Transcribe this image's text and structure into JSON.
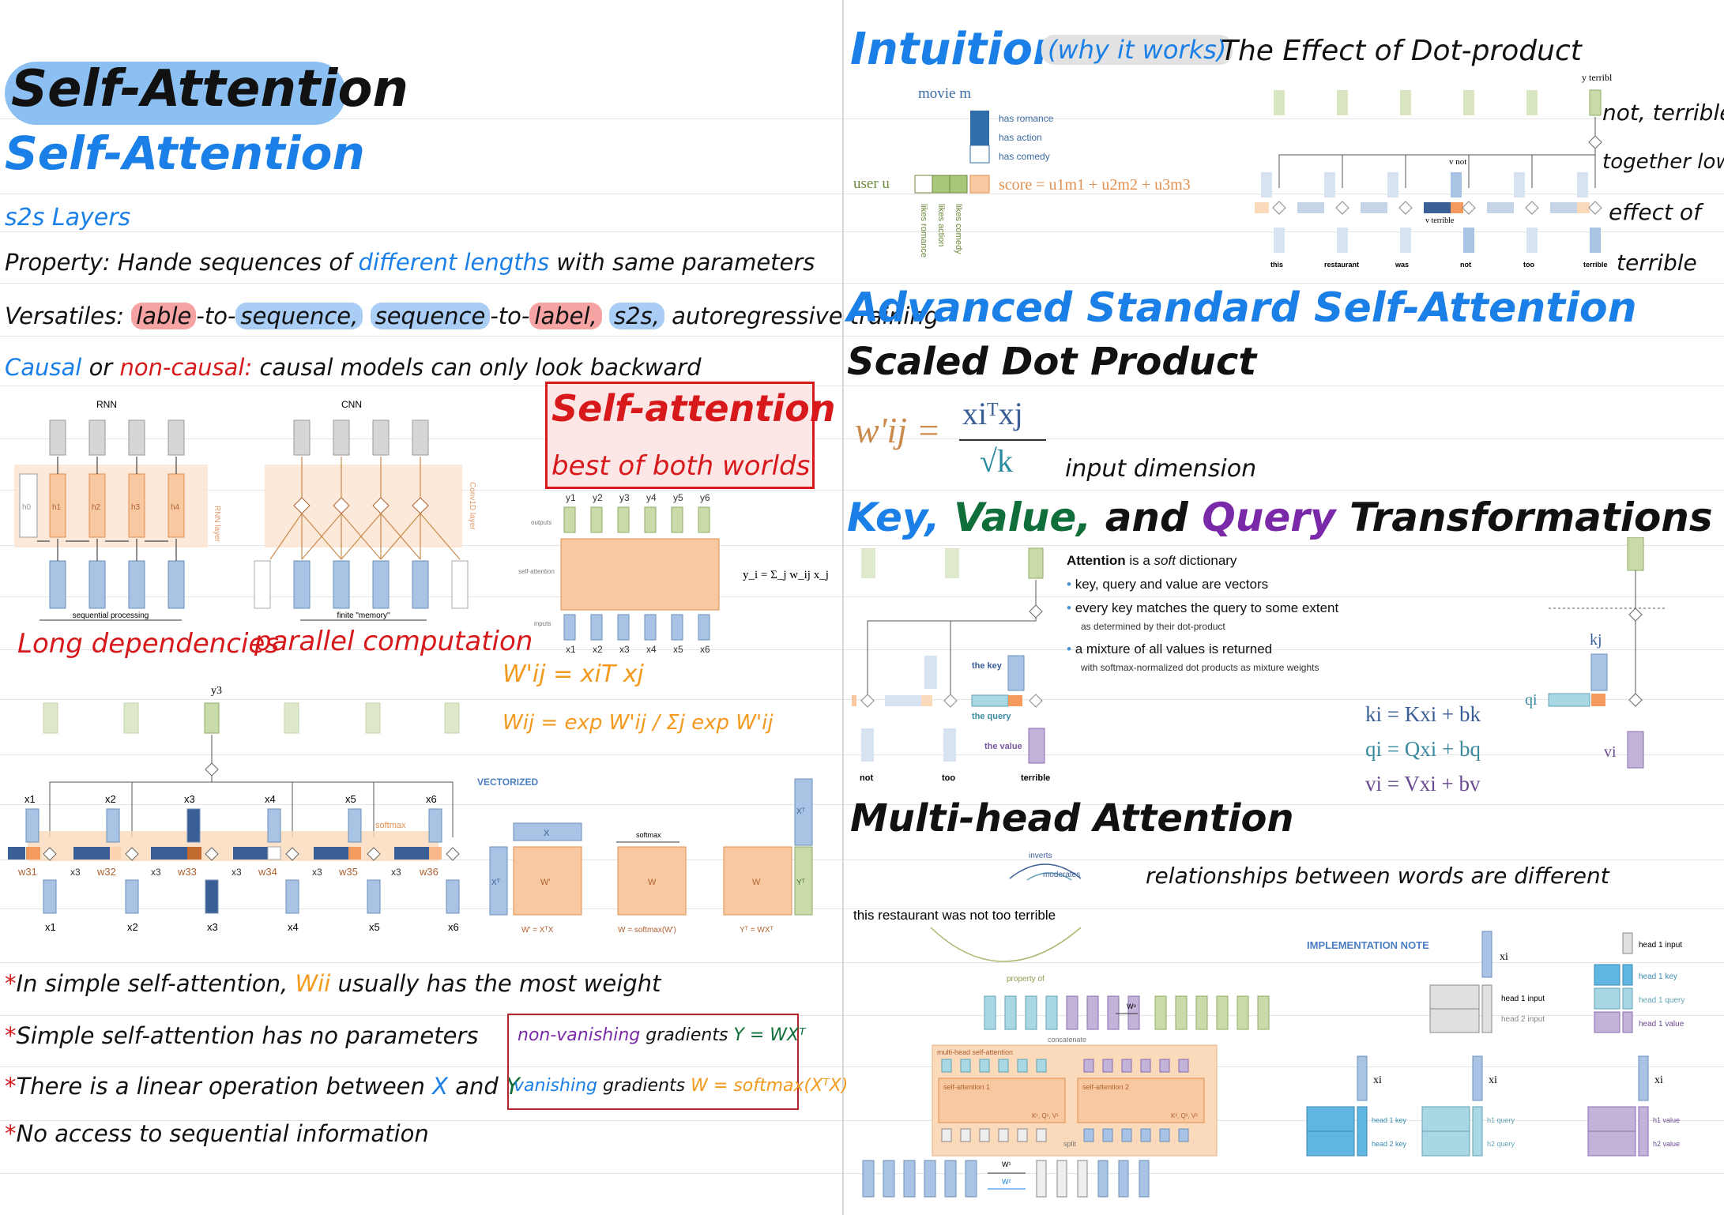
{
  "left": {
    "title_main": "Self-Attention",
    "title_sub": "Self-Attention",
    "section_s2s": "s2s Layers",
    "property_label": "Property:",
    "property_text_a": "Hande sequences of",
    "property_text_b": "different lengths",
    "property_text_c": "with same parameters",
    "versatile_label": "Versatiles:",
    "versatile_l2s_a": "lable",
    "versatile_l2s_b": "-to-",
    "versatile_l2s_c": "sequence,",
    "versatile_s2l_a": "sequence",
    "versatile_s2l_b": "-to-",
    "versatile_s2l_c": "label,",
    "versatile_s2s": "s2s,",
    "versatile_rest": "autoregressive training",
    "causal_a": "Causal",
    "causal_b": "or",
    "causal_c": "non-causal:",
    "causal_d": "causal models can only look backward",
    "rnn_label": "RNN",
    "cnn_label": "CNN",
    "rnn_layer": "RNN layer",
    "conv_layer": "Conv1D layer",
    "rnn_h": [
      "h0",
      "h1",
      "h2",
      "h3",
      "h4"
    ],
    "seq_processing": "sequential processing",
    "finite_memory": "finite \"memory\"",
    "long_dep": "Long dependencies",
    "parallel": "parallel computation",
    "sa_box_title": "Self-attention",
    "sa_box_sub": "best of both worlds",
    "sa_outputs": "outputs",
    "sa_self": "self-attention",
    "sa_inputs": "inputs",
    "sa_y": [
      "y1",
      "y2",
      "y3",
      "y4",
      "y5",
      "y6"
    ],
    "sa_x": [
      "x1",
      "x2",
      "x3",
      "x4",
      "x5",
      "x6"
    ],
    "sa_formula": "y_i = Σ_j w_ij x_j",
    "w_prime": "W'ij = xiT xj",
    "w_norm": "Wij = exp W'ij / Σj exp W'ij",
    "y3": "y3",
    "top_x": [
      "x1",
      "x2",
      "x3",
      "x4",
      "x5",
      "x6"
    ],
    "bottom_x": [
      "x1",
      "x2",
      "x3",
      "x4",
      "x5",
      "x6"
    ],
    "mid_x3": "x3",
    "weights": [
      "w31",
      "w32",
      "w33",
      "w34",
      "w35",
      "w36"
    ],
    "softmax_arrow": "softmax",
    "vectorized": "VECTORIZED",
    "v_X": "X",
    "v_XT": "Xᵀ",
    "v_Wp": "W'",
    "v_softmax": "softmax",
    "v_W": "W",
    "v_W2": "W",
    "v_YT": "Yᵀ",
    "v_XT2": "Xᵀ",
    "eq1": "W' = XᵀX",
    "eq2": "W = softmax(W')",
    "eq3": "Yᵀ = WXᵀ",
    "star": "*",
    "note1_a": "In simple self-attention,",
    "note1_b": "Wii",
    "note1_c": "usually has the most weight",
    "note2": "Simple self-attention has no parameters",
    "note3_a": "There is a linear operation between",
    "note3_b": "X",
    "note3_c": "and",
    "note3_d": "Y",
    "note4": "No access to sequential information",
    "grad1_a": "non-vanishing",
    "grad1_b": "gradients",
    "grad1_c": "Y = WXᵀ",
    "grad2_a": "vanishing",
    "grad2_b": "gradients",
    "grad2_c": "W = softmax(XᵀX)"
  },
  "right": {
    "intuition": "Intuition",
    "why": "(why it works)",
    "effect": "The Effect of Dot-product",
    "movie_m": "movie m",
    "user_u": "user u",
    "has_romance": "has romance",
    "has_action": "has action",
    "has_comedy": "has comedy",
    "likes_romance": "likes romance",
    "likes_action": "likes action",
    "likes_comedy": "likes comedy",
    "score": "score = u1m1 + u2m2 + u3m3",
    "y_terrible": "y terrible",
    "v_not": "v not",
    "v_terrible": "v terrible",
    "words": [
      "this",
      "restaurant",
      "was",
      "not",
      "too",
      "terrible"
    ],
    "note_not_terrible": "not, terrible",
    "note_together": "together lower",
    "note_effect": "effect of",
    "note_terrible": "terrible",
    "advanced": "Advanced Standard Self-Attention",
    "scaled": "Scaled Dot Product",
    "scaled_formula_lhs": "w'ij =",
    "scaled_num": "xiᵀxj",
    "scaled_den": "√k",
    "input_dim": "input dimension",
    "kvq_key": "Key,",
    "kvq_value": "Value,",
    "kvq_and": "and",
    "kvq_query": "Query",
    "kvq_rest": "Transformations",
    "attn_head_a": "Attention",
    "attn_head_b": "is a",
    "attn_head_c": "soft",
    "attn_head_d": "dictionary",
    "b1": "key, query and value are vectors",
    "b2": "every key matches the query to some extent",
    "b2_sub": "as determined by their dot-product",
    "b3": "a mixture of all values is returned",
    "b3_sub": "with softmax-normalized dot products as mixture weights",
    "the_key": "the key",
    "the_query": "the query",
    "the_value": "the value",
    "kvq_words": [
      "not",
      "too",
      "terrible"
    ],
    "eq_k": "ki = Kxi + bk",
    "eq_q": "qi = Qxi + bq",
    "eq_v": "vi = Vxi + bv",
    "kj": "kj",
    "qi": "qi",
    "vi": "vi",
    "multi": "Multi-head Attention",
    "sentence": "this   restaurant   was   not   too   terrible",
    "inverts": "inverts",
    "moderates": "moderates",
    "property_of": "property of",
    "relationships": "relationships between words are different",
    "mh_label": "multi-head self-attention",
    "sa1": "self-attention 1",
    "sa2": "self-attention 2",
    "kqv1": "K¹, Q¹, V¹",
    "kqv2": "K², Q², V²",
    "concatenate": "concatenate",
    "split": "split",
    "wo": "Wᵒ",
    "w1": "W¹",
    "w2": "W²",
    "impl_note": "IMPLEMENTATION NOTE",
    "xi": "xi",
    "head1_input": "head 1 input",
    "head2_input": "head 2 input",
    "head1_input_r": "head 1 input",
    "head1_key": "head 1 key",
    "head1_query": "head 1 query",
    "head1_value": "head 1 value",
    "head1_key2": "head 1 key",
    "head2_key": "head 2 key",
    "h1_query": "h1 query",
    "h2_query": "h2 query",
    "h1_value": "h1 value",
    "h2_value": "h2 value"
  },
  "colors": {
    "blue_ink": "#1a7fe6",
    "red_ink": "#d7191c",
    "green_ink": "#0f6e3a",
    "purple_ink": "#7a2aa8",
    "orange_ink": "#f39a1e",
    "vec_blue": "#a8c3e3",
    "vec_green": "#c9dba8",
    "vec_orange": "#f8c9a0",
    "vec_purple": "#c4b3d8",
    "vec_teal": "#a9d8e4"
  }
}
